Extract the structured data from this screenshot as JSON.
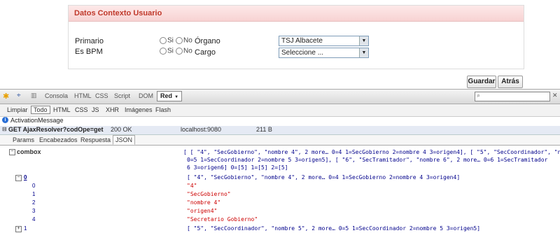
{
  "panel": {
    "title": "Datos Contexto Usuario"
  },
  "form": {
    "primario_label": "Primario",
    "esbpm_label": "Es BPM",
    "radio_si": "Si",
    "radio_no": "No",
    "organo_label": "Órgano",
    "organo_value": "TSJ Albacete",
    "cargo_label": "Cargo",
    "cargo_value": "Seleccione ..."
  },
  "buttons": {
    "guardar": "Guardar",
    "atras": "Atrás"
  },
  "firebug": {
    "tabs": [
      "Consola",
      "HTML",
      "CSS",
      "Script",
      "DOM",
      "Red"
    ],
    "active_tab": "Red",
    "subtoolbar": [
      "Limpiar",
      "Todo",
      "HTML",
      "CSS",
      "JS",
      "XHR",
      "Imágenes",
      "Flash"
    ],
    "info": "ActivationMessage",
    "request": {
      "method_url": "GET AjaxResolver?codOpe=get",
      "status": "200 OK",
      "host": "localhost:9080",
      "size": "211 B"
    },
    "response_tabs": [
      "Params",
      "Encabezados",
      "Respuesta",
      "JSON"
    ],
    "tree": {
      "root_key": "combox",
      "root_summary_1": "[ [ \"4\", \"SecGobierno\", \"nombre 4\", 2 more… 0=4 1=SecGobierno 2=nombre 4 3=origen4], [ \"5\", \"SecCoordinador\", \"nomb",
      "root_summary_2": "0=5 1=SecCoordinador 2=nombre 5 3=origen5], [ \"6\", \"SecTramitador\", \"nombre 6\", 2 more… 0=6 1=SecTramitador",
      "root_summary_3": "6 3=origen6] 0=[5] 1=[5] 2=[5]",
      "node0_key": "0",
      "node0_summary": "[ \"4\", \"SecGobierno\", \"nombre 4\", 2 more… 0=4 1=SecGobierno 2=nombre 4 3=origen4]",
      "items": [
        {
          "k": "0",
          "v": "\"4\""
        },
        {
          "k": "1",
          "v": "\"SecGobierno\""
        },
        {
          "k": "2",
          "v": "\"nombre 4\""
        },
        {
          "k": "3",
          "v": "\"origen4\""
        },
        {
          "k": "4",
          "v": "\"Secretario Gobierno\""
        }
      ],
      "node1_key": "1",
      "node1_summary": "[ \"5\", \"SecCoordinador\", \"nombre 5\", 2 more… 0=5 1=SecCoordinador 2=nombre 5 3=origen5]"
    }
  }
}
